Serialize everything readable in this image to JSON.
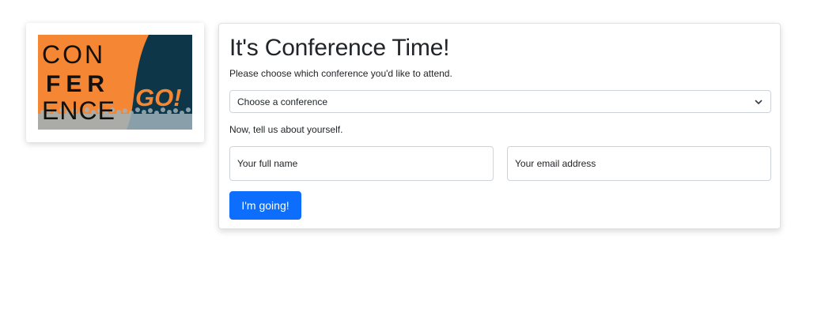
{
  "logo": {
    "line1": "CON",
    "line2": "FER",
    "line3": "ENCE",
    "tagline": "GO!",
    "colors": {
      "orange": "#f58634",
      "navy": "#0d3648",
      "crowd": "#9fb3bd"
    }
  },
  "form": {
    "title": "It's Conference Time!",
    "subtitle": "Please choose which conference you'd like to attend.",
    "conference_select": {
      "selected": "Choose a conference"
    },
    "about_prompt": "Now, tell us about yourself.",
    "name_field": {
      "placeholder": "Your full name",
      "value": ""
    },
    "email_field": {
      "placeholder": "Your email address",
      "value": ""
    },
    "submit_label": "I'm going!",
    "accent_color": "#0d6efd"
  }
}
